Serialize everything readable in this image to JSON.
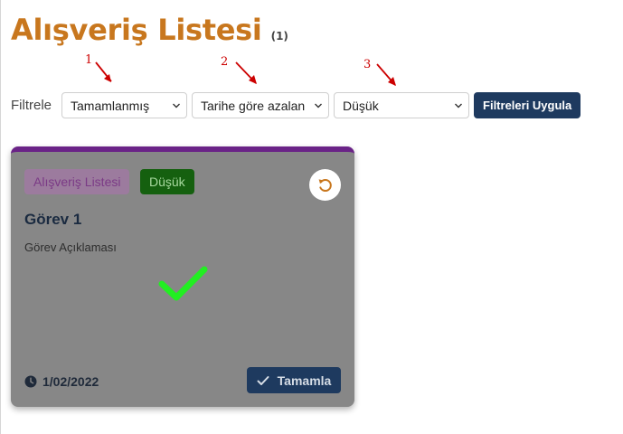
{
  "header": {
    "title": "Alışveriş Listesi",
    "count": "(1)"
  },
  "annotations": [
    "1",
    "2",
    "3"
  ],
  "filters": {
    "label": "Filtrele",
    "status_value": "Tamamlanmış",
    "sort_value": "Tarihe göre azalan",
    "priority_value": "Düşük",
    "apply_label": "Filtreleri Uygula"
  },
  "task": {
    "category_tag": "Alışveriş Listesi",
    "priority_tag": "Düşük",
    "title": "Görev 1",
    "description": "Görev Açıklaması",
    "date": "1/02/2022",
    "complete_label": "Tamamla",
    "completed": true
  },
  "colors": {
    "title": "#c8771e",
    "card_background": "#878787",
    "card_border": "#6a2387",
    "button": "#1e3a5f",
    "check": "#22ee22",
    "annotation": "#cc0000"
  },
  "icons": {
    "dropdown": "chevron-down-icon",
    "undo": "undo-icon",
    "completed": "check-icon",
    "date": "clock-icon",
    "complete_button": "check-icon"
  }
}
